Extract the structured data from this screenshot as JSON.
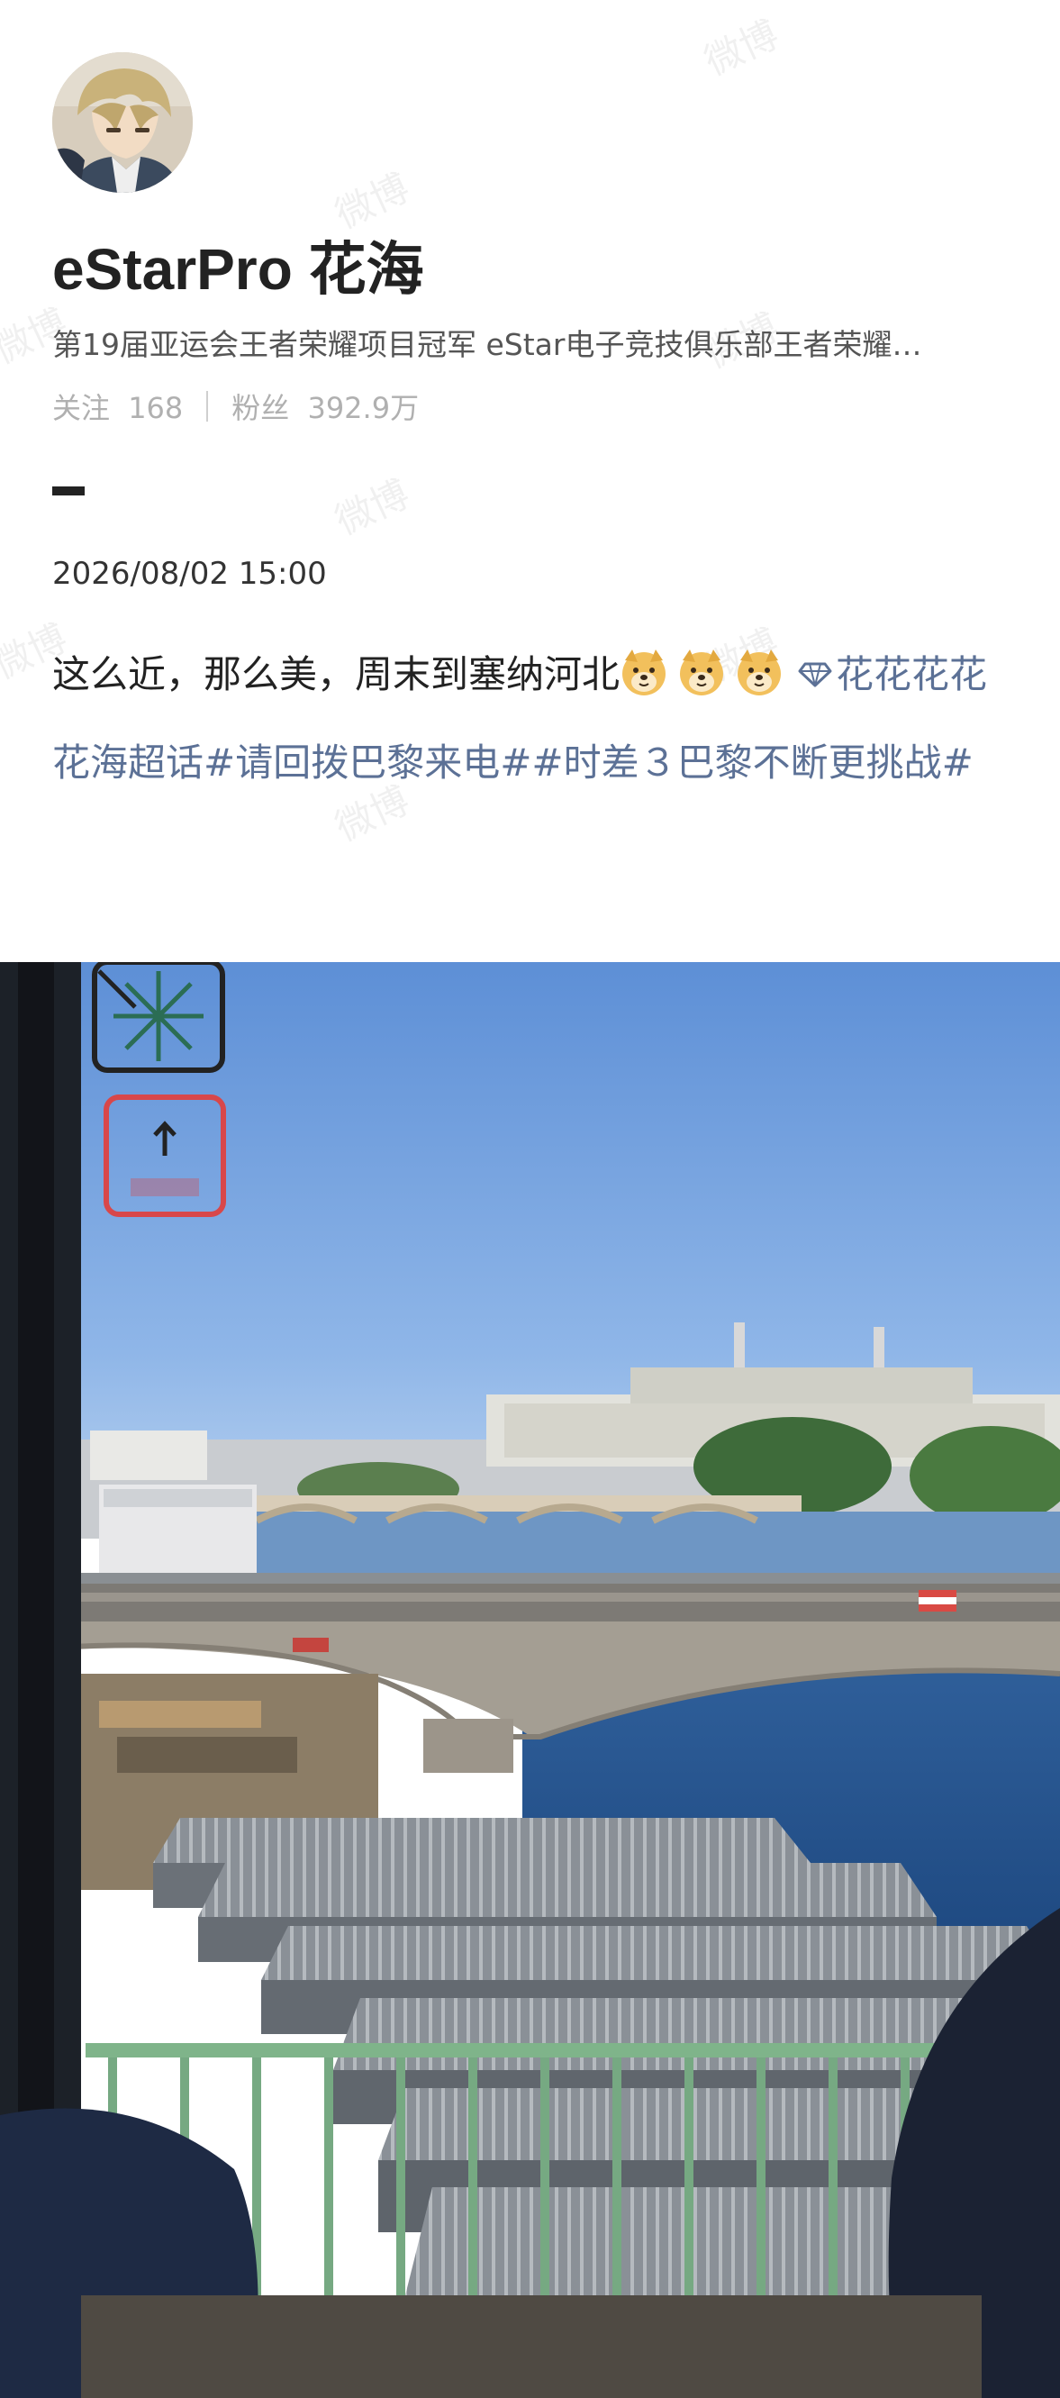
{
  "profile": {
    "username": "eStarPro 花海",
    "bio": "第19届亚运会王者荣耀项目冠军   eStar电子竞技俱乐部王者荣耀…",
    "following_label": "关注",
    "following_count": "168",
    "followers_label": "粉丝",
    "followers_count": "392.9万"
  },
  "post": {
    "timestamp": "2026/08/02 15:00",
    "text_plain": "这么近，那么美，周末到塞纳河北",
    "emojis": [
      "doge-emoji",
      "doge-emoji",
      "doge-emoji"
    ],
    "topic_icon": "diamond-icon",
    "topic_1": "花花花花花海超话",
    "topic_2": "#请回拨巴黎来电#",
    "topic_3": "#时差３巴黎不断更挑战#"
  },
  "watermark_text": "微博",
  "colors": {
    "link": "#5c7196",
    "text": "#222222",
    "muted": "#b0b0b0"
  },
  "photo": {
    "icon": "photo-seine-bridge"
  }
}
